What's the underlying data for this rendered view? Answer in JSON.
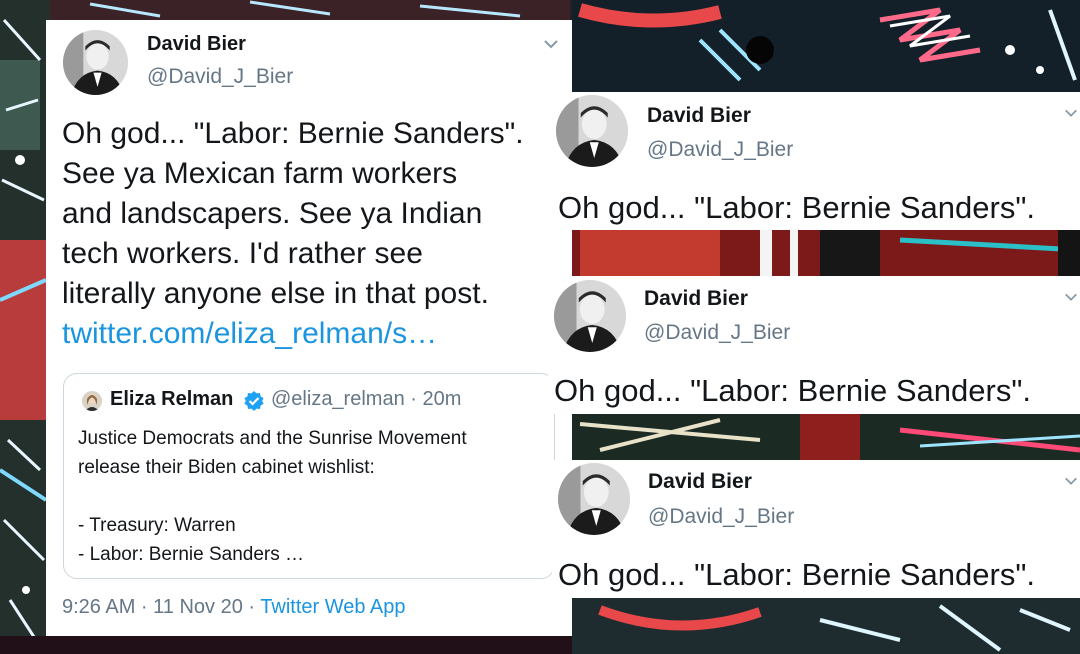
{
  "colors": {
    "link_blue": "#1b95e0",
    "text_dark": "#14171a",
    "text_gray": "#657786",
    "verified_blue": "#1da1f2"
  },
  "main_tweet": {
    "author_name": "David Bier",
    "author_handle": "@David_J_Bier",
    "avatar_icon": "avatar-photo",
    "menu_icon": "chevron-down-icon",
    "text": "Oh god... \"Labor: Bernie Sanders\".\nSee ya Mexican farm workers\nand landscapers. See ya Indian\ntech workers. I'd rather see\nliterally anyone else in that post.",
    "link": "twitter.com/eliza_relman/s…",
    "quoted_tweet": {
      "author_name": "Eliza Relman",
      "verified_icon": "verified-badge-icon",
      "meta": "@eliza_relman · 20m",
      "lines": [
        "Justice Democrats and the Sunrise Movement",
        "release their Biden cabinet wishlist:",
        "",
        "- Treasury: Warren",
        "- Labor: Bernie Sanders …"
      ]
    },
    "timestamp": "9:26 AM · 11 Nov 20 · ",
    "source_app": "Twitter Web App"
  },
  "repeated_tweets": [
    {
      "author_name": "David Bier",
      "author_handle": "@David_J_Bier",
      "text": "Oh god... \"Labor: Bernie Sanders\"."
    },
    {
      "author_name": "David Bier",
      "author_handle": "@David_J_Bier",
      "text": "Oh god... \"Labor: Bernie Sanders\"."
    },
    {
      "author_name": "David Bier",
      "author_handle": "@David_J_Bier",
      "text": "Oh god... \"Labor: Bernie Sanders\"."
    }
  ]
}
